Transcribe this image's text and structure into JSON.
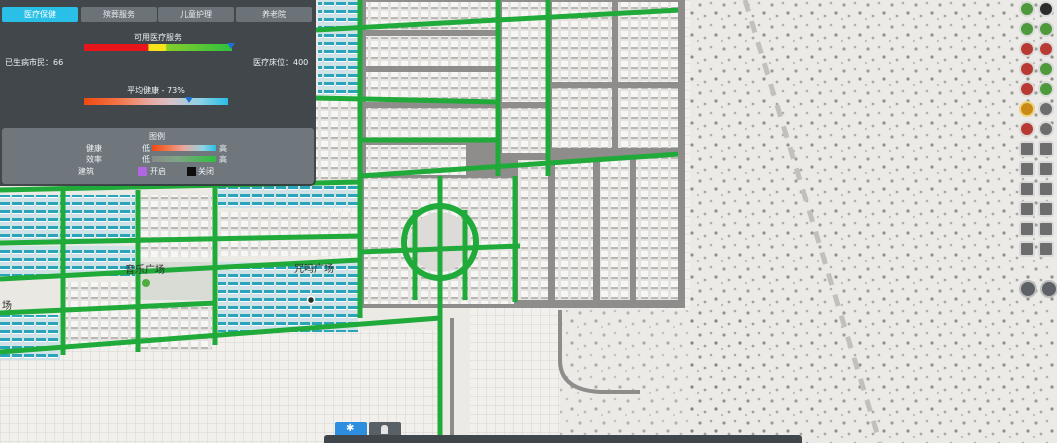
{
  "panel": {
    "tabs": [
      {
        "label": "医疗保健",
        "active": true
      },
      {
        "label": "殡葬服务",
        "active": false
      },
      {
        "label": "儿童护理",
        "active": false
      },
      {
        "label": "养老院",
        "active": false
      }
    ],
    "available_title": "可用医疗服务",
    "sick_label": "已生病市民：66",
    "beds_label": "医疗床位：400",
    "avg_health_label": "平均健康 - 73%",
    "avg_health_percent": 73
  },
  "legend": {
    "title": "图例",
    "rows": [
      {
        "name": "健康",
        "low": "低",
        "high": "高"
      },
      {
        "name": "效率",
        "low": "低",
        "high": "高"
      }
    ],
    "building_label": "建筑",
    "on_label": "开启",
    "off_label": "关闭"
  },
  "map_labels": {
    "music_square": "音乐广场",
    "square2": "咒吗广场",
    "edge": "场"
  },
  "colors": {
    "road_green": "#1faa3a",
    "road_gray": "#8f8c8c",
    "accent": "#29bfe6",
    "panel_bg": "#343a40"
  }
}
